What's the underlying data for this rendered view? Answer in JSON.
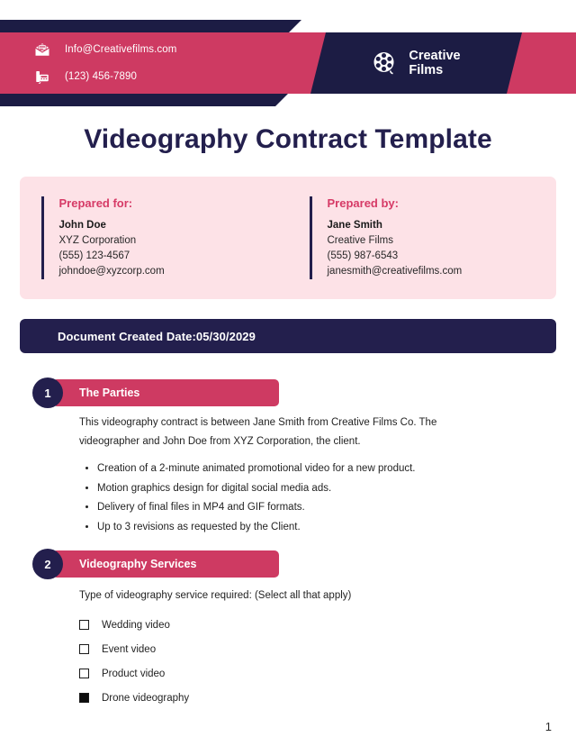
{
  "header": {
    "contacts": [
      {
        "icon": "envelope-icon",
        "text": "Info@Creativefilms.com"
      },
      {
        "icon": "fax-phone-icon",
        "text": "(123) 456-7890"
      }
    ],
    "brand": {
      "icon": "film-reel-icon",
      "line1": "Creative",
      "line2": "Films"
    }
  },
  "title": "Videography Contract Template",
  "prepared": {
    "for": {
      "heading": "Prepared for:",
      "name": "John Doe",
      "company": "XYZ Corporation",
      "phone": "(555) 123-4567",
      "email": "johndoe@xyzcorp.com"
    },
    "by": {
      "heading": "Prepared by:",
      "name": "Jane Smith",
      "company": "Creative Films",
      "phone": "(555) 987-6543",
      "email": "janesmith@creativefilms.com"
    }
  },
  "date_banner": "Document Created Date:05/30/2029",
  "sections": [
    {
      "number": "1",
      "title": "The Parties",
      "paragraph": "This videography contract is between Jane Smith from Creative Films Co. The videographer and John Doe from XYZ Corporation, the client.",
      "bullets": [
        "Creation of a 2-minute animated promotional video for a new product.",
        "Motion graphics design for digital social media ads.",
        "Delivery of final files in MP4 and GIF formats.",
        "Up to 3 revisions as requested by the Client."
      ]
    },
    {
      "number": "2",
      "title": "Videography Services",
      "paragraph": "Type of videography service required: (Select all that apply)",
      "checkboxes": [
        {
          "label": "Wedding video",
          "checked": false
        },
        {
          "label": "Event video",
          "checked": false
        },
        {
          "label": "Product video",
          "checked": false
        },
        {
          "label": "Drone videography",
          "checked": true
        }
      ]
    }
  ],
  "page_number": "1",
  "colors": {
    "navy": "#231f4d",
    "pink": "#ce3a62",
    "pink_light": "#fde2e7",
    "accent_text": "#d63a66"
  }
}
